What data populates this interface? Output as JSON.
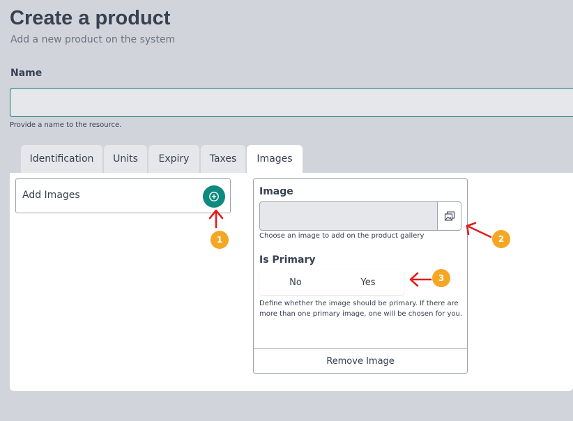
{
  "page": {
    "title": "Create a product",
    "subtitle": "Add a new product on the system"
  },
  "name_field": {
    "label": "Name",
    "value": "",
    "placeholder": "",
    "help": "Provide a name to the resource.",
    "border_color": "#0f766e"
  },
  "tabs": [
    {
      "label": "Identification",
      "active": false
    },
    {
      "label": "Units",
      "active": false
    },
    {
      "label": "Expiry",
      "active": false
    },
    {
      "label": "Taxes",
      "active": false
    },
    {
      "label": "Images",
      "active": true
    }
  ],
  "images_panel": {
    "add_label": "Add Images",
    "add_icon": "plus-circle-icon",
    "image_card": {
      "image_label": "Image",
      "image_value": "",
      "image_picker_icon": "gallery-icon",
      "image_help": "Choose an image to add on the product gallery",
      "primary_label": "Is Primary",
      "options": [
        "No",
        "Yes"
      ],
      "primary_help": "Define whether the image should be primary. If there are more than one primary image, one will be chosen for you.",
      "remove_label": "Remove Image"
    }
  },
  "annotations": {
    "badges": [
      "1",
      "2",
      "3"
    ],
    "badge_color": "#f5a623",
    "arrow_color": "#e11d1d"
  },
  "colors": {
    "accent": "#0f8a7e",
    "background": "#d1d5db",
    "tab_inactive": "#e5e7eb"
  }
}
